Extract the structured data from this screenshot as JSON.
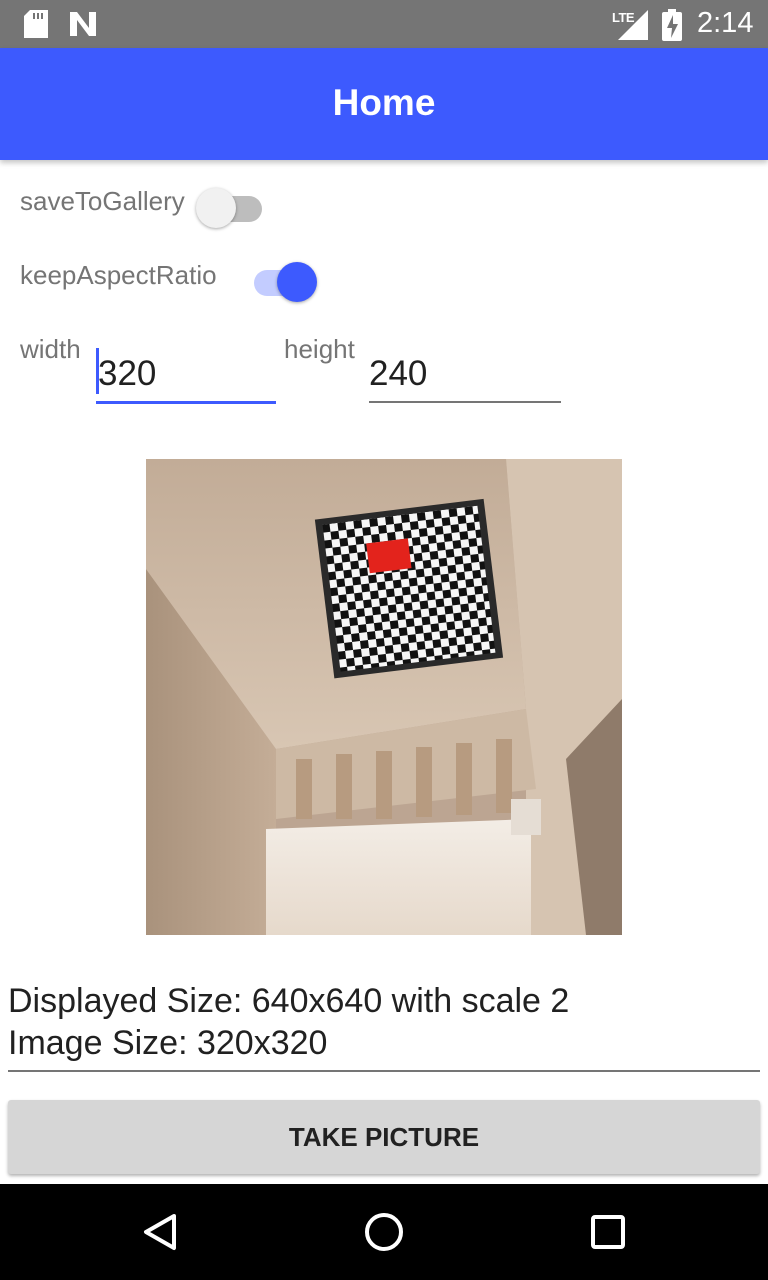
{
  "status_bar": {
    "time": "2:14",
    "network": "LTE",
    "icons": [
      "sd-card-icon",
      "n-icon",
      "signal-icon",
      "battery-charging-icon"
    ]
  },
  "app_bar": {
    "title": "Home",
    "color": "#3d5afe"
  },
  "options": {
    "save_to_gallery": {
      "label": "saveToGallery",
      "checked": false
    },
    "keep_aspect_ratio": {
      "label": "keepAspectRatio",
      "checked": true
    }
  },
  "dimensions": {
    "width_label": "width",
    "width_value": "320",
    "height_label": "height",
    "height_value": "240"
  },
  "preview": {
    "icon": "camera-photo-preview"
  },
  "info": {
    "displayed_size": "Displayed Size: 640x640 with scale 2",
    "image_size": "Image Size: 320x320"
  },
  "actions": {
    "take_picture": "TAKE PICTURE"
  },
  "nav": {
    "icons": [
      "back-icon",
      "home-icon",
      "recents-icon"
    ]
  }
}
